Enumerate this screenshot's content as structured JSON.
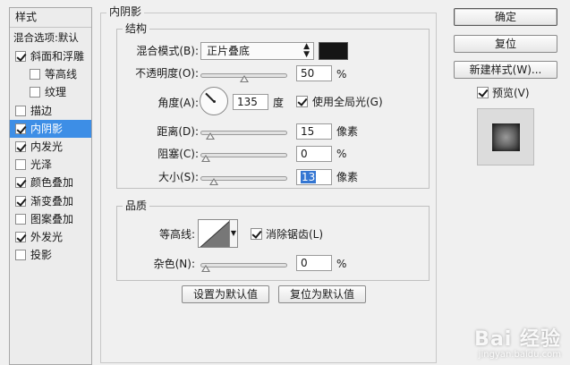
{
  "styles_panel": {
    "header": "样式",
    "blend_options": "混合选项:默认",
    "items": [
      {
        "label": "斜面和浮雕",
        "checked": true,
        "indent": false,
        "selected": false
      },
      {
        "label": "等高线",
        "checked": false,
        "indent": true,
        "selected": false
      },
      {
        "label": "纹理",
        "checked": false,
        "indent": true,
        "selected": false
      },
      {
        "label": "描边",
        "checked": false,
        "indent": false,
        "selected": false
      },
      {
        "label": "内阴影",
        "checked": true,
        "indent": false,
        "selected": true
      },
      {
        "label": "内发光",
        "checked": true,
        "indent": false,
        "selected": false
      },
      {
        "label": "光泽",
        "checked": false,
        "indent": false,
        "selected": false
      },
      {
        "label": "颜色叠加",
        "checked": true,
        "indent": false,
        "selected": false
      },
      {
        "label": "渐变叠加",
        "checked": true,
        "indent": false,
        "selected": false
      },
      {
        "label": "图案叠加",
        "checked": false,
        "indent": false,
        "selected": false
      },
      {
        "label": "外发光",
        "checked": true,
        "indent": false,
        "selected": false
      },
      {
        "label": "投影",
        "checked": false,
        "indent": false,
        "selected": false
      }
    ]
  },
  "inner_shadow": {
    "title": "内阴影",
    "structure": {
      "title": "结构",
      "blend_mode_label": "混合模式(B):",
      "blend_mode_value": "正片叠底",
      "blend_color": "#151515",
      "opacity_label": "不透明度(O):",
      "opacity_value": "50",
      "opacity_unit": "%",
      "opacity_level": 0.5,
      "angle_label": "角度(A):",
      "angle_value": "135",
      "angle_unit": "度",
      "global_light_label": "使用全局光(G)",
      "global_light_checked": true,
      "distance_label": "距离(D):",
      "distance_value": "15",
      "distance_unit": "像素",
      "distance_level": 0.06,
      "choke_label": "阻塞(C):",
      "choke_value": "0",
      "choke_unit": "%",
      "choke_level": 0.0,
      "size_label": "大小(S):",
      "size_value": "13",
      "size_unit": "像素",
      "size_level": 0.1
    },
    "quality": {
      "title": "品质",
      "contour_label": "等高线:",
      "antialias_label": "消除锯齿(L)",
      "antialias_checked": true,
      "noise_label": "杂色(N):",
      "noise_value": "0",
      "noise_unit": "%",
      "noise_level": 0.0
    },
    "set_default_button": "设置为默认值",
    "reset_default_button": "复位为默认值"
  },
  "right_panel": {
    "ok_button": "确定",
    "reset_button": "复位",
    "new_style_button": "新建样式(W)...",
    "preview_label": "预览(V)",
    "preview_checked": true
  },
  "watermark": {
    "brand": "Bai 经验",
    "url": "jingyan.baidu.com"
  }
}
